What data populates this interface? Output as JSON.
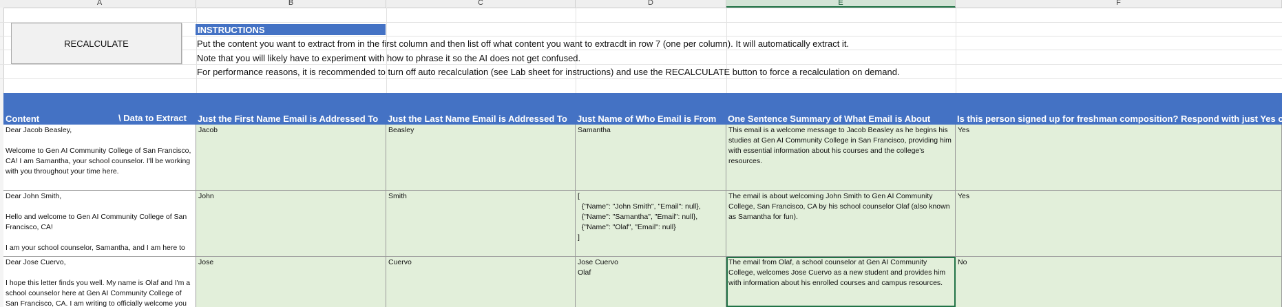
{
  "column_headers": [
    "A",
    "B",
    "C",
    "D",
    "E",
    "F"
  ],
  "button": {
    "label": "RECALCULATE"
  },
  "instructions": {
    "title": "INSTRUCTIONS",
    "lines": [
      "Put the content you want to extract from in the first column and then list off what content you want to extracdt in row 7 (one per column). It will automatically extract it.",
      "Note that you will likely have to experiment with how to phrase it so the AI does not get confused.",
      "For performance reasons, it is recommended to turn off auto recalculation (see Lab sheet for instructions) and use the RECALCULATE button to force a recalculation on demand."
    ]
  },
  "table": {
    "headers": {
      "content": "Content",
      "data_to_extract": "\\ Data to Extract",
      "b": "Just the First Name Email is Addressed To",
      "c": "Just the Last Name Email is Addressed To",
      "d": "Just Name of Who Email is From",
      "e": "One Sentence Summary of What Email is About",
      "f": "Is this person signed up for freshman composition? Respond with just Yes o"
    },
    "rows": [
      {
        "content": "Dear Jacob Beasley,\n\nWelcome to Gen AI Community College of San Francisco, CA! I am Samantha, your school counselor. I'll be working with you throughout your time here.",
        "b": "Jacob",
        "c": "Beasley",
        "d": "Samantha",
        "e": "This email is a welcome message to Jacob Beasley as he begins his studies at Gen AI Community College in San Francisco, providing him with essential information about his courses and the college's resources.",
        "f": "Yes"
      },
      {
        "content": "Dear John Smith,\n\nHello and welcome to Gen AI Community College of San Francisco, CA!\n\nI am your school counselor, Samantha, and I am here to",
        "b": "John",
        "c": "Smith",
        "d": "[\n  {\"Name\": \"John Smith\", \"Email\": null},\n  {\"Name\": \"Samantha\", \"Email\": null},\n  {\"Name\": \"Olaf\", \"Email\": null}\n]",
        "e": "The email is about welcoming John Smith to Gen AI Community College, San Francisco, CA by his school counselor Olaf (also known as Samantha for fun).",
        "f": "Yes"
      },
      {
        "content": "Dear Jose Cuervo,\n\nI hope this letter finds you well. My name is Olaf and I'm a school counselor here at Gen AI Community College of San Francisco, CA. I am writing to officially welcome you to our",
        "b": "Jose",
        "c": "Cuervo",
        "d": "Jose Cuervo\nOlaf",
        "e": "The email from Olaf, a school counselor at Gen AI Community College, welcomes Jose Cuervo as a new student and provides him with information about his enrolled courses and campus resources.",
        "f": "No"
      }
    ]
  }
}
